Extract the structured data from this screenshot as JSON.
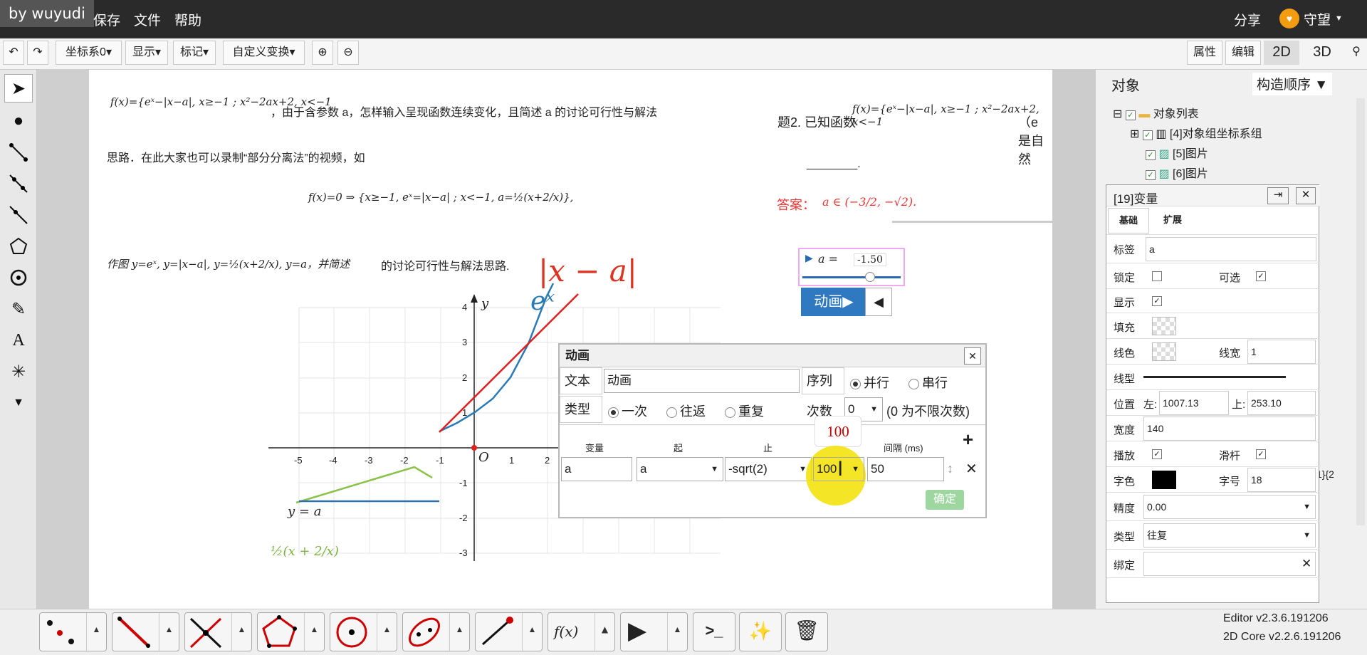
{
  "watermark": "by wuyudi",
  "menu": {
    "save": "保存",
    "file": "文件",
    "help": "帮助",
    "share": "分享",
    "user": "守望"
  },
  "toolbar": {
    "coord": "坐标系0",
    "display": "显示",
    "mark": "标记",
    "transform": "自定义变换",
    "attr": "属性",
    "edit": "编辑",
    "v2d": "2D",
    "v3d": "3D"
  },
  "doc": {
    "formula1": "f(x)={eˣ−|x−a|, x≥−1 ; x²−2ax+2, x<−1",
    "line1": "，由于含参数 a，怎样输入呈现函数连续变化，且简述 a 的讨论可行性与解法",
    "line2": "思路．在此大家也可以录制“部分分离法”的视频，如",
    "formula2": "f(x)=0 ⇒ {x≥−1, eˣ=|x−a| ; x<−1, a=½(x+2/x)},",
    "line3a": "作图 y=eˣ, y=|x−a|, y=½(x+2/x), y=a，并简述",
    "line3b": "的讨论可行性与解法思路.",
    "q2": "题2. 已知函数",
    "q2formula": "f(x)={eˣ−|x−a|, x≥−1 ; x²−2ax+2, x<−1",
    "q2tail": "（e 是自然",
    "blank": "________.",
    "answer_label": "答案：",
    "answer": "a ∈ (−3/2, −√2)."
  },
  "plot": {
    "label_abs": "|x − a|",
    "label_exp": "eˣ",
    "label_ya": "y = a",
    "label_half": "½(x + 2/x)",
    "axis_y": "y",
    "origin": "O",
    "xticks": [
      "-5",
      "-4",
      "-3",
      "-2",
      "-1",
      "1",
      "2"
    ],
    "yticks": [
      "4",
      "3",
      "2",
      "1",
      "-1",
      "-2",
      "-3"
    ]
  },
  "slider": {
    "text": "a = ",
    "value": "-1.50"
  },
  "anim_btn": "动画▶",
  "anim_back": "◀",
  "dialog": {
    "title": "动画",
    "text_label": "文本",
    "text_value": "动画",
    "seq_label": "序列",
    "seq_parallel": "并行",
    "seq_serial": "串行",
    "type_label": "类型",
    "type_once": "一次",
    "type_back": "往返",
    "type_repeat": "重复",
    "count_label": "次数",
    "count_value": "0",
    "count_hint": "(0 为不限次数)",
    "col_var": "变量",
    "col_start": "起",
    "col_end": "止",
    "col_interval": "间隔 (ms)",
    "tooltip": "100",
    "row_name": "a",
    "row_var": "a",
    "row_end": "-sqrt(2)",
    "row_steps": "100",
    "row_interval": "50",
    "ok": "确定"
  },
  "panel": {
    "tab_obj": "对象",
    "tab_order": "构造顺序 ▼",
    "root": "对象列表",
    "item4": "[4]对象组坐标系组",
    "item5": "[5]图片",
    "item6": "[6]图片"
  },
  "varpanel": {
    "title": "[19]变量",
    "tab_basic": "基础",
    "tab_ext": "扩展",
    "label": "标签",
    "label_value": "a",
    "lock": "锁定",
    "selectable": "可选",
    "show": "显示",
    "fill": "填充",
    "linecolor": "线色",
    "linewidth": "线宽",
    "linewidth_value": "1",
    "linetype": "线型",
    "pos": "位置",
    "left": "左:",
    "left_value": "1007.13",
    "top": "上:",
    "top_value": "253.10",
    "width": "宽度",
    "width_value": "140",
    "play": "播放",
    "slider": "滑杆",
    "fontcolor": "字色",
    "fontsize": "字号",
    "fontsize_value": "18",
    "precision": "精度",
    "precision_value": "0.00",
    "type": "类型",
    "type_value": "往复",
    "bind": "绑定"
  },
  "side_frag": "1}{2",
  "version": {
    "editor": "Editor v2.3.6.191206",
    "core": "2D Core v2.2.6.191206"
  }
}
